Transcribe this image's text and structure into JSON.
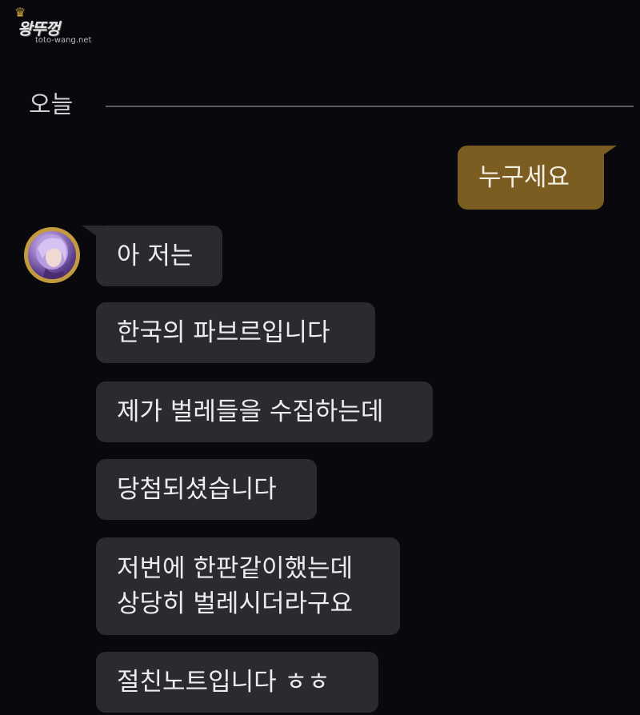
{
  "watermark": {
    "title": "왕뚜껑",
    "url": "toto-wang.net"
  },
  "chat": {
    "date_separator": "오늘",
    "outgoing": [
      {
        "text": "누구세요"
      }
    ],
    "incoming": [
      {
        "text": "아 저는"
      },
      {
        "text": "한국의 파브르입니다"
      },
      {
        "text": "제가 벌레들을 수집하는데"
      },
      {
        "text": "당첨되셨습니다"
      },
      {
        "text": "저번에 한판같이했는데\n상당히 벌레시더라구요"
      },
      {
        "text": "절친노트입니다 ㅎㅎ"
      }
    ],
    "colors": {
      "background": "#08080d",
      "incoming_bubble": "#2a2b30",
      "outgoing_bubble": "#7b5d22",
      "avatar_ring": "#c39b3e"
    },
    "avatar_icon": "purple-hair-character-icon"
  }
}
